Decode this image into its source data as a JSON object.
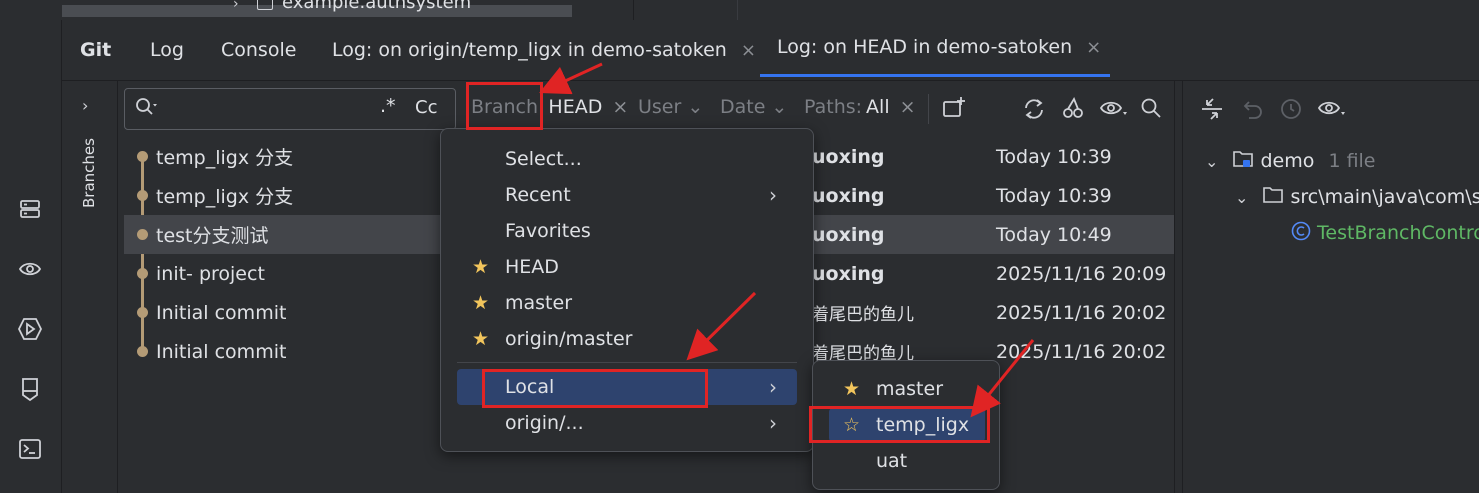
{
  "top": {
    "filename": "example.authsystem"
  },
  "tabs": [
    {
      "label": "Git"
    },
    {
      "label": "Log"
    },
    {
      "label": "Console"
    },
    {
      "label": "Log: on origin/temp_ligx in demo-satoken",
      "close": "×"
    },
    {
      "label": "Log: on HEAD in demo-satoken",
      "close": "×"
    }
  ],
  "sidebar": {
    "branches_label": "Branches"
  },
  "search": {
    "regex": ".*",
    "case": "Cc"
  },
  "filters": {
    "branch_label": "Branch:",
    "branch_value": "HEAD",
    "user": "User",
    "date": "Date",
    "paths_label": "Paths:",
    "paths_value": "All"
  },
  "commits": [
    {
      "subject": "temp_ligx  分支",
      "author": "uoxing",
      "date": "Today 10:39"
    },
    {
      "subject": "temp_ligx  分支",
      "author": "uoxing",
      "date": "Today 10:39"
    },
    {
      "subject": "test分支测试",
      "author": "uoxing",
      "date": "Today 10:49"
    },
    {
      "subject": "init- project",
      "author": "uoxing",
      "date": "2025/11/16 20:09"
    },
    {
      "subject": "Initial commit",
      "author": "着尾巴的鱼儿",
      "date": "2025/11/16 20:02"
    },
    {
      "subject": "Initial commit",
      "author": "着尾巴的鱼儿",
      "date": "2025/11/16 20:02"
    }
  ],
  "changes": {
    "root": "demo",
    "root_count": "1 file",
    "path": "src\\main\\java\\com\\sa",
    "file": "TestBranchContro",
    "file_color": "#5fb865"
  },
  "branch_menu": {
    "items": [
      {
        "label": "Select..."
      },
      {
        "label": "Recent",
        "arrow": "›"
      },
      {
        "label": "Favorites"
      },
      {
        "label": "HEAD",
        "star": "★"
      },
      {
        "label": "master",
        "star": "★"
      },
      {
        "label": "origin/master",
        "star": "★"
      }
    ],
    "local": {
      "label": "Local",
      "arrow": "›"
    },
    "origin": {
      "label": "origin/...",
      "arrow": "›"
    }
  },
  "local_submenu": [
    {
      "label": "master",
      "star": "★"
    },
    {
      "label": "temp_ligx",
      "star": "☆"
    },
    {
      "label": "uat"
    }
  ],
  "colors": {
    "accent": "#3574f0",
    "highlight_box": "#e02424",
    "star": "#f2c55c",
    "menu_hover": "#2e436e"
  }
}
